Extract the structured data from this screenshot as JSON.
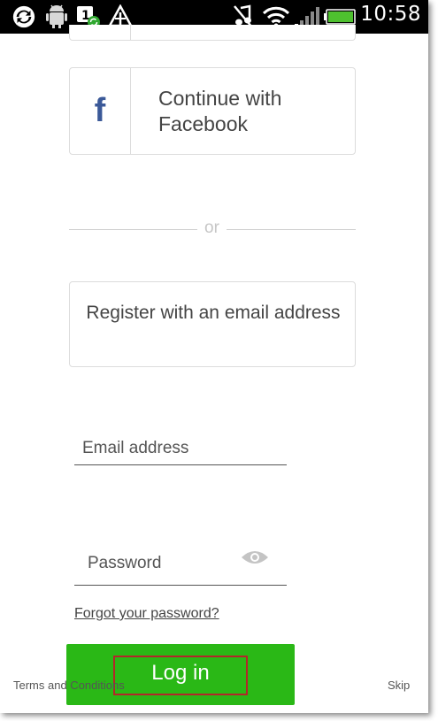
{
  "status_bar": {
    "time": "10:58",
    "icons": [
      "sync-icon",
      "android-debug-icon",
      "notification-badge-icon",
      "warning-triangle-icon",
      "muted-music-icon",
      "wifi-icon",
      "signal-icon",
      "battery-icon"
    ]
  },
  "facebook_button": {
    "icon_letter": "f",
    "label": "Continue with Facebook"
  },
  "divider": {
    "label": "or"
  },
  "register_button": {
    "label": "Register with an email address"
  },
  "email_field": {
    "placeholder": "Email address"
  },
  "password_field": {
    "placeholder": "Password"
  },
  "forgot_password": {
    "label": "Forgot your password?"
  },
  "login_button": {
    "label": "Log in"
  },
  "footer": {
    "terms_label": "Terms and Conditions",
    "skip_label": "Skip"
  },
  "colors": {
    "status_bar_bg": "#000000",
    "facebook_blue": "#3b5998",
    "login_green": "#2ab816",
    "highlight_red": "#b3262a"
  }
}
